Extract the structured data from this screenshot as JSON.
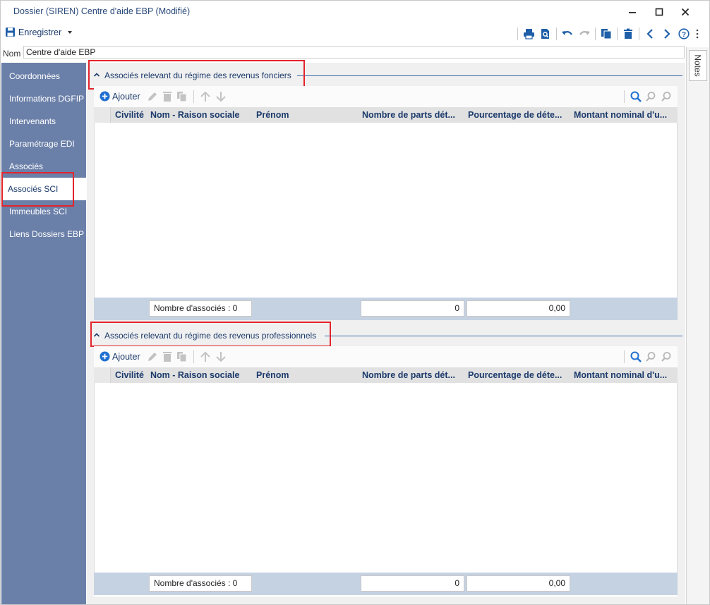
{
  "window": {
    "title": "Dossier (SIREN) Centre d'aide EBP (Modifié)"
  },
  "toolbar": {
    "save_label": "Enregistrer"
  },
  "form": {
    "nom_label": "Nom",
    "nom_value": "Centre d'aide EBP"
  },
  "sidebar": {
    "items": [
      {
        "label": "Coordonnées"
      },
      {
        "label": "Informations DGFIP"
      },
      {
        "label": "Intervenants"
      },
      {
        "label": "Paramétrage EDI"
      },
      {
        "label": "Associés"
      },
      {
        "label": "Associés SCI"
      },
      {
        "label": "Immeubles SCI"
      },
      {
        "label": "Liens Dossiers EBP"
      }
    ],
    "active_index": 5
  },
  "notes_tab": "Notes",
  "groups": [
    {
      "title": "Associés relevant du régime des revenus fonciers",
      "add_label": "Ajouter",
      "columns": [
        "Civilité",
        "Nom - Raison sociale",
        "Prénom",
        "Nombre de parts dét...",
        "Pourcentage de déte...",
        "Montant nominal d'u..."
      ],
      "footer": {
        "count_label": "Nombre d'associés : 0",
        "parts_total": "0",
        "percent_total": "0,00"
      }
    },
    {
      "title": "Associés relevant du régime des revenus professionnels",
      "add_label": "Ajouter",
      "columns": [
        "Civilité",
        "Nom - Raison sociale",
        "Prénom",
        "Nombre de parts dét...",
        "Pourcentage de déte...",
        "Montant nominal d'u..."
      ],
      "footer": {
        "count_label": "Nombre d'associés : 0",
        "parts_total": "0",
        "percent_total": "0,00"
      }
    }
  ],
  "colors": {
    "sidebar": "#6b80a9",
    "accent": "#1b3a6b",
    "highlight_border": "#e3242b",
    "grid_footer": "#c5d2e2"
  }
}
